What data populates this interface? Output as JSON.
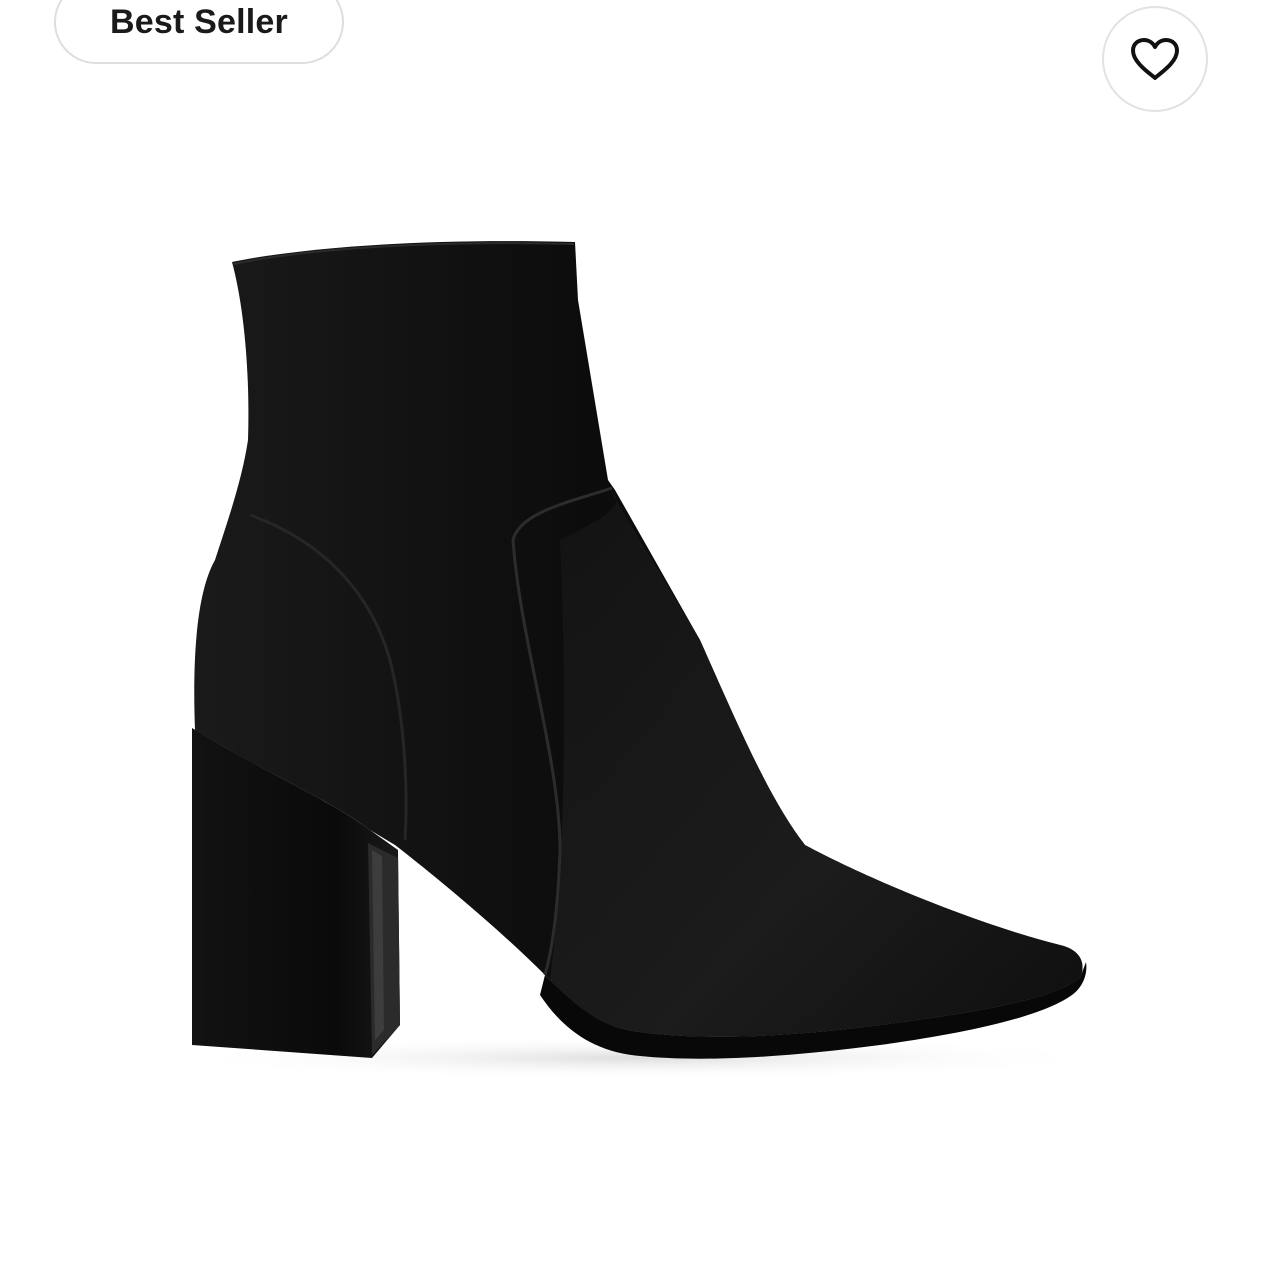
{
  "product_card": {
    "badge_label": "Best Seller",
    "favorite_icon": "heart-outline-icon",
    "product_image": "black-leather-ankle-boot"
  },
  "colors": {
    "badge_border": "#dedede",
    "text": "#1a1a1a",
    "boot": "#0f0f0f",
    "background": "#ffffff"
  }
}
